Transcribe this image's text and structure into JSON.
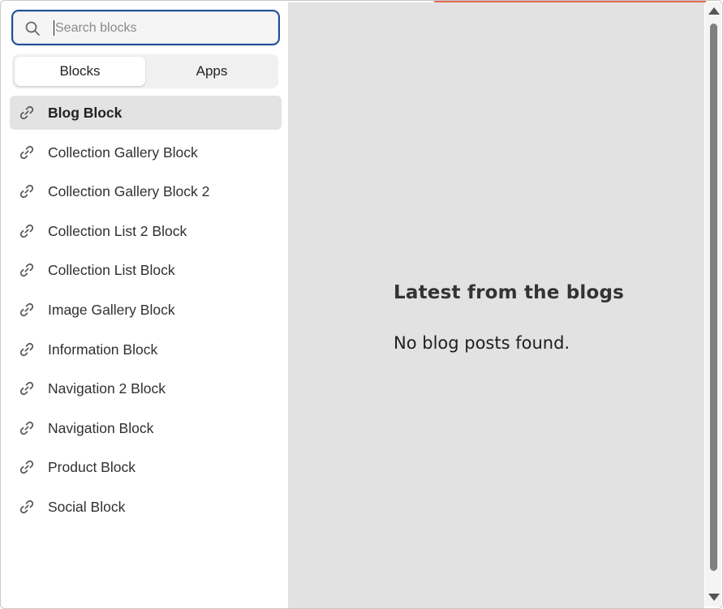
{
  "search": {
    "placeholder": "Search blocks",
    "value": ""
  },
  "tabs": [
    {
      "label": "Blocks",
      "active": true
    },
    {
      "label": "Apps",
      "active": false
    }
  ],
  "blocks": [
    {
      "label": "Blog Block",
      "icon": "link-icon",
      "selected": true
    },
    {
      "label": "Collection Gallery Block",
      "icon": "link-icon"
    },
    {
      "label": "Collection Gallery Block 2",
      "icon": "link-icon"
    },
    {
      "label": "Collection List 2 Block",
      "icon": "link-icon"
    },
    {
      "label": "Collection List Block",
      "icon": "link-icon"
    },
    {
      "label": "Image Gallery Block",
      "icon": "link-icon"
    },
    {
      "label": "Information Block",
      "icon": "link-icon"
    },
    {
      "label": "Navigation 2 Block",
      "icon": "link-icon"
    },
    {
      "label": "Navigation Block",
      "icon": "link-icon"
    },
    {
      "label": "Product Block",
      "icon": "link-icon"
    },
    {
      "label": "Social Block",
      "icon": "link-icon"
    }
  ],
  "preview": {
    "title": "Latest from the blogs",
    "empty_message": "No blog posts found."
  },
  "colors": {
    "focus_border": "#1f4e95",
    "selected_row": "#e3e3e3",
    "preview_bg": "#e2e2e2",
    "accent": "#e86a55"
  }
}
